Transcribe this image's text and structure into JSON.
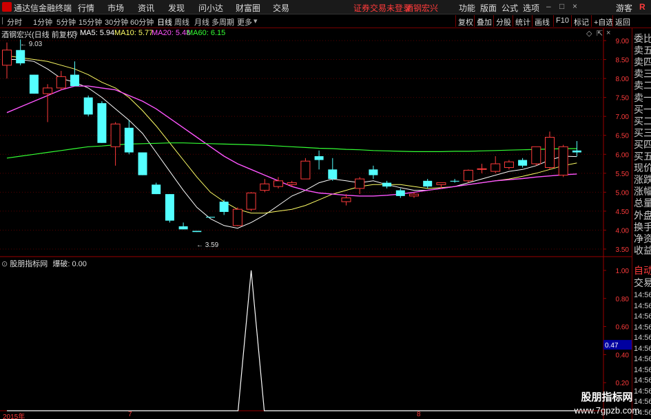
{
  "app": {
    "title": "通达信金融终端",
    "menu": [
      "行情",
      "市场",
      "资讯",
      "发现",
      "问小达",
      "财富圈",
      "交易"
    ],
    "notice": "证券交易未登录",
    "stock_name": "酒钢宏兴",
    "right_menu": [
      "功能",
      "版面",
      "公式",
      "选项",
      "游客"
    ],
    "window_buttons": [
      "–",
      "□",
      "×"
    ]
  },
  "toolbar": {
    "periods": [
      "分时",
      "1分钟",
      "5分钟",
      "15分钟",
      "30分钟",
      "60分钟",
      "日线",
      "周线",
      "月线",
      "多周期",
      "更多"
    ],
    "active_period": "日线",
    "right_buttons": [
      "复权",
      "叠加",
      "分股",
      "统计",
      "画线",
      "F10",
      "标记",
      "+自选",
      "返回"
    ]
  },
  "chart_header": {
    "stock": "酒钢宏兴(日线 前复权)",
    "ma5": "MA5: 5.94",
    "ma10": "MA10: 5.77",
    "ma20": "MA20: 5.48",
    "ma60": "MA60: 6.15",
    "colors": {
      "ma5": "#ffffff",
      "ma10": "#ffff66",
      "ma20": "#ff55ff",
      "ma60": "#33ff33"
    }
  },
  "indicator_header": {
    "name": "股朋指标网",
    "value": "爆破: 0.00"
  },
  "chart_data": [
    {
      "type": "candlestick",
      "price_axis": {
        "min": 3.5,
        "max": 9.0,
        "ticks": [
          "9.00",
          "8.50",
          "8.00",
          "7.50",
          "7.00",
          "6.50",
          "6.00",
          "5.50",
          "5.00",
          "4.50",
          "4.00",
          "3.50"
        ]
      },
      "high_annotation": "9.03",
      "low_annotation": "3.59",
      "colors": {
        "up": "#ff3b3b",
        "down": "#54ffff"
      },
      "candles": [
        {
          "o": 8.35,
          "c": 8.75,
          "h": 8.95,
          "l": 8.0
        },
        {
          "o": 8.75,
          "c": 8.4,
          "h": 9.03,
          "l": 8.35
        },
        {
          "o": 8.1,
          "c": 7.6,
          "h": 8.1,
          "l": 7.6
        },
        {
          "o": 7.6,
          "c": 7.75,
          "h": 7.85,
          "l": 6.85
        },
        {
          "o": 7.75,
          "c": 8.05,
          "h": 8.2,
          "l": 7.7
        },
        {
          "o": 8.1,
          "c": 7.8,
          "h": 8.45,
          "l": 7.8
        },
        {
          "o": 7.5,
          "c": 7.05,
          "h": 7.55,
          "l": 7.0
        },
        {
          "o": 7.35,
          "c": 6.3,
          "h": 7.4,
          "l": 6.3
        },
        {
          "o": 6.2,
          "c": 6.8,
          "h": 6.85,
          "l": 5.7
        },
        {
          "o": 6.7,
          "c": 6.05,
          "h": 6.9,
          "l": 6.0
        },
        {
          "o": 6.05,
          "c": 5.45,
          "h": 6.05,
          "l": 5.45
        },
        {
          "o": 5.2,
          "c": 4.95,
          "h": 5.25,
          "l": 4.95
        },
        {
          "o": 4.95,
          "c": 4.25,
          "h": 4.95,
          "l": 4.2
        },
        {
          "o": 4.1,
          "c": 4.02,
          "h": 4.2,
          "l": 4.02
        },
        {
          "o": 3.98,
          "c": 3.95,
          "h": 3.98,
          "l": 3.95
        },
        {
          "o": 4.35,
          "c": 4.33,
          "h": 4.35,
          "l": 4.33
        },
        {
          "o": 4.75,
          "c": 4.48,
          "h": 4.8,
          "l": 4.4
        },
        {
          "o": 4.12,
          "c": 4.55,
          "h": 4.6,
          "l": 4.1
        },
        {
          "o": 4.55,
          "c": 4.98,
          "h": 5.0,
          "l": 4.5
        },
        {
          "o": 5.05,
          "c": 5.22,
          "h": 5.35,
          "l": 5.0
        },
        {
          "o": 5.15,
          "c": 5.3,
          "h": 5.4,
          "l": 5.1
        },
        {
          "o": 5.2,
          "c": 5.25,
          "h": 5.3,
          "l": 5.15
        },
        {
          "o": 5.35,
          "c": 5.82,
          "h": 5.9,
          "l": 5.35
        },
        {
          "o": 5.95,
          "c": 5.85,
          "h": 6.1,
          "l": 5.6
        },
        {
          "o": 5.6,
          "c": 5.35,
          "h": 5.9,
          "l": 5.3
        },
        {
          "o": 4.75,
          "c": 4.85,
          "h": 4.95,
          "l": 4.65
        },
        {
          "o": 5.1,
          "c": 5.35,
          "h": 5.4,
          "l": 4.95
        },
        {
          "o": 5.6,
          "c": 5.45,
          "h": 5.7,
          "l": 5.35
        },
        {
          "o": 5.25,
          "c": 5.15,
          "h": 5.3,
          "l": 5.1
        },
        {
          "o": 5.05,
          "c": 4.9,
          "h": 5.1,
          "l": 4.85
        },
        {
          "o": 4.9,
          "c": 4.95,
          "h": 5.0,
          "l": 4.85
        },
        {
          "o": 5.3,
          "c": 5.15,
          "h": 5.35,
          "l": 5.1
        },
        {
          "o": 5.2,
          "c": 5.25,
          "h": 5.25,
          "l": 5.1
        },
        {
          "o": 5.3,
          "c": 5.28,
          "h": 5.35,
          "l": 5.25
        },
        {
          "o": 5.3,
          "c": 5.58,
          "h": 5.6,
          "l": 5.25
        },
        {
          "o": 5.6,
          "c": 5.62,
          "h": 5.75,
          "l": 5.5
        },
        {
          "o": 5.55,
          "c": 5.75,
          "h": 5.95,
          "l": 5.5
        },
        {
          "o": 5.65,
          "c": 5.8,
          "h": 5.85,
          "l": 5.6
        },
        {
          "o": 5.85,
          "c": 5.7,
          "h": 5.9,
          "l": 5.65
        },
        {
          "o": 5.75,
          "c": 6.2,
          "h": 6.2,
          "l": 5.7
        },
        {
          "o": 5.65,
          "c": 6.45,
          "h": 6.6,
          "l": 5.6
        },
        {
          "o": 5.45,
          "c": 6.2,
          "h": 6.25,
          "l": 5.4
        },
        {
          "o": 6.1,
          "c": 6.05,
          "h": 6.35,
          "l": 5.95
        }
      ],
      "series": [
        {
          "name": "MA5",
          "values": [
            8.5,
            8.5,
            8.45,
            8.25,
            8.0,
            7.9,
            7.75,
            7.5,
            7.2,
            6.9,
            6.55,
            6.05,
            5.55,
            5.05,
            4.6,
            4.3,
            4.12,
            4.05,
            4.2,
            4.4,
            4.65,
            4.9,
            5.05,
            5.25,
            5.35,
            5.3,
            5.25,
            5.3,
            5.2,
            5.12,
            5.05,
            5.05,
            5.1,
            5.15,
            5.25,
            5.35,
            5.45,
            5.55,
            5.6,
            5.7,
            5.85,
            5.95,
            5.94
          ]
        },
        {
          "name": "MA10",
          "values": [
            8.6,
            8.55,
            8.5,
            8.45,
            8.35,
            8.25,
            8.1,
            7.9,
            7.75,
            7.5,
            7.15,
            6.75,
            6.3,
            5.85,
            5.4,
            5.0,
            4.75,
            4.55,
            4.45,
            4.45,
            4.5,
            4.55,
            4.65,
            4.8,
            4.95,
            5.05,
            5.15,
            5.2,
            5.2,
            5.2,
            5.15,
            5.1,
            5.12,
            5.15,
            5.2,
            5.25,
            5.3,
            5.35,
            5.42,
            5.5,
            5.6,
            5.7,
            5.77
          ]
        },
        {
          "name": "MA20",
          "values": [
            7.1,
            7.25,
            7.4,
            7.55,
            7.7,
            7.8,
            7.8,
            7.75,
            7.7,
            7.55,
            7.4,
            7.2,
            6.95,
            6.7,
            6.45,
            6.2,
            5.95,
            5.75,
            5.6,
            5.45,
            5.3,
            5.15,
            5.05,
            4.98,
            4.95,
            4.92,
            4.9,
            4.9,
            4.92,
            4.95,
            5.0,
            5.05,
            5.1,
            5.15,
            5.2,
            5.25,
            5.3,
            5.33,
            5.36,
            5.4,
            5.43,
            5.46,
            5.48
          ]
        },
        {
          "name": "MA60",
          "values": [
            5.9,
            5.95,
            6.0,
            6.05,
            6.1,
            6.15,
            6.2,
            6.22,
            6.25,
            6.27,
            6.28,
            6.29,
            6.3,
            6.3,
            6.29,
            6.28,
            6.27,
            6.26,
            6.25,
            6.24,
            6.22,
            6.2,
            6.18,
            6.16,
            6.15,
            6.13,
            6.12,
            6.1,
            6.09,
            6.08,
            6.07,
            6.07,
            6.07,
            6.08,
            6.08,
            6.09,
            6.1,
            6.11,
            6.12,
            6.13,
            6.14,
            6.15,
            6.15
          ]
        }
      ]
    },
    {
      "type": "line",
      "name": "爆破",
      "y_axis": {
        "ticks": [
          "1.00",
          "0.80",
          "0.60",
          "0.40",
          "0.20"
        ],
        "marker": "0.47"
      },
      "values": [
        0,
        0,
        0,
        0,
        0,
        0,
        0,
        0,
        0,
        0,
        0,
        0,
        0,
        0,
        0,
        0,
        0,
        0,
        1,
        0,
        0,
        0,
        0,
        0,
        0,
        0,
        0,
        0,
        0,
        0,
        0,
        0,
        0,
        0,
        0,
        0,
        0,
        0,
        0,
        0,
        0,
        0,
        0
      ],
      "x_labels": [
        "2015年",
        "7",
        "8"
      ]
    }
  ],
  "right_panel": {
    "labels": [
      "委比",
      "卖五",
      "卖四",
      "卖三",
      "卖二",
      "卖一",
      "买一",
      "买二",
      "买三",
      "买四",
      "买五",
      "现价",
      "涨跌",
      "涨幅",
      "总量",
      "外盘",
      "换手",
      "净资",
      "收益"
    ],
    "lower_labels": [
      "自动",
      "交易"
    ],
    "times": [
      "14:56",
      "14:56",
      "14:56",
      "14:56",
      "14:56",
      "14:56",
      "14:56",
      "14:56",
      "14:56",
      "14:56",
      "14:56",
      "14:56",
      "14:56"
    ]
  },
  "watermark": {
    "line1": "股朋指标网",
    "line2": "www.7gpzb.com"
  }
}
